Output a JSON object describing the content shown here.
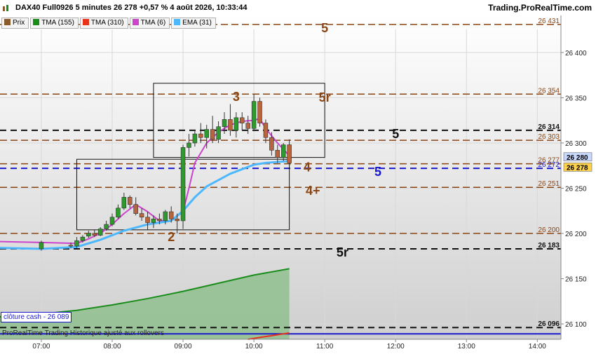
{
  "header": {
    "title": "DAX40 Full0926 5 minutes 26 278 +0,57 % 4 août 2026, 10:33:44",
    "brand": "Trading.ProRealTime.com"
  },
  "legend": [
    {
      "label": "Prix",
      "color": "#8b5a2b",
      "icon": "candlestick-icon"
    },
    {
      "label": "TMA (155)",
      "color": "#1a8c1a",
      "icon": "color-swatch-icon"
    },
    {
      "label": "TMA (310)",
      "color": "#e8331a",
      "icon": "color-swatch-icon"
    },
    {
      "label": "TMA (6)",
      "color": "#cc44cc",
      "icon": "color-swatch-icon"
    },
    {
      "label": "EMA (31)",
      "color": "#4db8ff",
      "icon": "color-swatch-icon"
    }
  ],
  "footer": {
    "cash_close": "clôture cash - 26 089",
    "note": "ProRealTime Trading Historique ajusté aux rollovers"
  },
  "chart_data": {
    "type": "candlestick",
    "ylim": [
      26083,
      26441
    ],
    "xlim": [
      "06:25",
      "14:20"
    ],
    "yticks": [
      26100,
      26150,
      26200,
      26250,
      26300,
      26350,
      26400
    ],
    "xticks": [
      "07:00",
      "08:00",
      "09:00",
      "10:00",
      "11:00",
      "12:00",
      "13:00",
      "14:00"
    ],
    "candles": [
      {
        "t": "07:00",
        "o": 26183,
        "h": 26192,
        "l": 26181,
        "c": 26190
      },
      {
        "t": "07:25",
        "o": 26187,
        "h": 26190,
        "l": 26184,
        "c": 26186
      },
      {
        "t": "07:30",
        "o": 26186,
        "h": 26196,
        "l": 26184,
        "c": 26192
      },
      {
        "t": "07:35",
        "o": 26192,
        "h": 26198,
        "l": 26190,
        "c": 26196
      },
      {
        "t": "07:40",
        "o": 26197,
        "h": 26203,
        "l": 26195,
        "c": 26200
      },
      {
        "t": "07:45",
        "o": 26200,
        "h": 26204,
        "l": 26196,
        "c": 26198
      },
      {
        "t": "07:50",
        "o": 26198,
        "h": 26207,
        "l": 26197,
        "c": 26205
      },
      {
        "t": "07:55",
        "o": 26205,
        "h": 26214,
        "l": 26203,
        "c": 26210
      },
      {
        "t": "08:00",
        "o": 26210,
        "h": 26222,
        "l": 26208,
        "c": 26218
      },
      {
        "t": "08:05",
        "o": 26218,
        "h": 26232,
        "l": 26216,
        "c": 26228
      },
      {
        "t": "08:10",
        "o": 26228,
        "h": 26245,
        "l": 26226,
        "c": 26240
      },
      {
        "t": "08:15",
        "o": 26240,
        "h": 26242,
        "l": 26228,
        "c": 26232
      },
      {
        "t": "08:20",
        "o": 26232,
        "h": 26240,
        "l": 26220,
        "c": 26222
      },
      {
        "t": "08:25",
        "o": 26222,
        "h": 26228,
        "l": 26214,
        "c": 26218
      },
      {
        "t": "08:30",
        "o": 26218,
        "h": 26224,
        "l": 26204,
        "c": 26212
      },
      {
        "t": "08:35",
        "o": 26212,
        "h": 26220,
        "l": 26206,
        "c": 26216
      },
      {
        "t": "08:40",
        "o": 26216,
        "h": 26222,
        "l": 26210,
        "c": 26214
      },
      {
        "t": "08:45",
        "o": 26214,
        "h": 26226,
        "l": 26210,
        "c": 26224
      },
      {
        "t": "08:50",
        "o": 26224,
        "h": 26230,
        "l": 26212,
        "c": 26216
      },
      {
        "t": "08:55",
        "o": 26216,
        "h": 26222,
        "l": 26200,
        "c": 26214
      },
      {
        "t": "09:00",
        "o": 26214,
        "h": 26298,
        "l": 26205,
        "c": 26295
      },
      {
        "t": "09:05",
        "o": 26295,
        "h": 26310,
        "l": 26285,
        "c": 26300
      },
      {
        "t": "09:10",
        "o": 26300,
        "h": 26314,
        "l": 26296,
        "c": 26310
      },
      {
        "t": "09:15",
        "o": 26310,
        "h": 26322,
        "l": 26300,
        "c": 26306
      },
      {
        "t": "09:20",
        "o": 26306,
        "h": 26320,
        "l": 26294,
        "c": 26315
      },
      {
        "t": "09:25",
        "o": 26315,
        "h": 26330,
        "l": 26300,
        "c": 26304
      },
      {
        "t": "09:30",
        "o": 26304,
        "h": 26324,
        "l": 26300,
        "c": 26318
      },
      {
        "t": "09:35",
        "o": 26318,
        "h": 26334,
        "l": 26310,
        "c": 26326
      },
      {
        "t": "09:40",
        "o": 26326,
        "h": 26343,
        "l": 26308,
        "c": 26314
      },
      {
        "t": "09:45",
        "o": 26314,
        "h": 26334,
        "l": 26306,
        "c": 26328
      },
      {
        "t": "09:50",
        "o": 26328,
        "h": 26334,
        "l": 26314,
        "c": 26322
      },
      {
        "t": "09:55",
        "o": 26322,
        "h": 26330,
        "l": 26310,
        "c": 26316
      },
      {
        "t": "10:00",
        "o": 26316,
        "h": 26354,
        "l": 26313,
        "c": 26346
      },
      {
        "t": "10:05",
        "o": 26346,
        "h": 26350,
        "l": 26318,
        "c": 26322
      },
      {
        "t": "10:10",
        "o": 26322,
        "h": 26326,
        "l": 26300,
        "c": 26306
      },
      {
        "t": "10:15",
        "o": 26306,
        "h": 26312,
        "l": 26286,
        "c": 26292
      },
      {
        "t": "10:20",
        "o": 26292,
        "h": 26298,
        "l": 26278,
        "c": 26284
      },
      {
        "t": "10:25",
        "o": 26284,
        "h": 26300,
        "l": 26280,
        "c": 26298
      },
      {
        "t": "10:30",
        "o": 26298,
        "h": 26304,
        "l": 26274,
        "c": 26278
      }
    ],
    "series": [
      {
        "name": "TMA (155)",
        "color": "#1a8c1a",
        "x": [
          "06:25",
          "07:00",
          "07:30",
          "08:00",
          "08:30",
          "09:00",
          "09:30",
          "10:00",
          "10:30"
        ],
        "y": [
          26108,
          26111,
          26115,
          26121,
          26128,
          26136,
          26145,
          26154,
          26161
        ]
      },
      {
        "name": "TMA (310)",
        "color": "#e8331a",
        "x": [
          "09:55",
          "10:05",
          "10:15",
          "10:25",
          "10:30"
        ],
        "y": [
          26083,
          26085,
          26087,
          26089,
          26090
        ]
      },
      {
        "name": "TMA (6)",
        "color": "#cc44cc",
        "x": [
          "06:25",
          "07:00",
          "07:30",
          "07:40",
          "07:50",
          "08:00",
          "08:10",
          "08:20",
          "08:30",
          "08:40",
          "08:50",
          "09:00",
          "09:05",
          "09:10",
          "09:20",
          "09:30",
          "09:40",
          "09:50",
          "10:00",
          "10:05",
          "10:10",
          "10:20",
          "10:30"
        ],
        "y": [
          26191,
          26190,
          26189,
          26194,
          26200,
          26210,
          26222,
          26232,
          26224,
          26214,
          26214,
          26224,
          26250,
          26278,
          26300,
          26312,
          26320,
          26324,
          26325,
          26327,
          26316,
          26300,
          26286
        ]
      },
      {
        "name": "EMA (31)",
        "color": "#4db8ff",
        "x": [
          "06:25",
          "07:00",
          "07:30",
          "07:50",
          "08:10",
          "08:30",
          "08:50",
          "09:00",
          "09:10",
          "09:20",
          "09:40",
          "10:00",
          "10:10",
          "10:20",
          "10:30"
        ],
        "y": [
          26184,
          26183,
          26185,
          26193,
          26203,
          26210,
          26214,
          26225,
          26240,
          26252,
          26266,
          26276,
          26278,
          26279,
          26280
        ]
      }
    ],
    "hlines": [
      {
        "y": 26431,
        "label": "26 431",
        "color": "#8b4513",
        "style": "dash-long"
      },
      {
        "y": 26354,
        "label": "26 354",
        "color": "#8b4513",
        "style": "dash-long"
      },
      {
        "y": 26314,
        "label": "26 314",
        "color": "#111111",
        "style": "dash-black"
      },
      {
        "y": 26303,
        "label": "26 303",
        "color": "#8b4513",
        "style": "dash-long"
      },
      {
        "y": 26277,
        "label": "26 277",
        "color": "#8b4513",
        "style": "dash-long"
      },
      {
        "y": 26272,
        "label": "26 272",
        "color": "#1a1acc",
        "style": "dash-blue"
      },
      {
        "y": 26251,
        "label": "26 251",
        "color": "#8b4513",
        "style": "dash-long"
      },
      {
        "y": 26200,
        "label": "26 200",
        "color": "#8b4513",
        "style": "dash-long"
      },
      {
        "y": 26183,
        "label": "26 183",
        "color": "#111111",
        "style": "dash-black"
      },
      {
        "y": 26096,
        "label": "26 096",
        "color": "#111111",
        "style": "dash-black"
      }
    ],
    "solid_line": {
      "y": 26089,
      "color": "#1a1acc"
    },
    "rects": [
      {
        "t1": "07:30",
        "t2": "10:30",
        "y1": 26204,
        "y2": 26282
      },
      {
        "t1": "08:35",
        "t2": "11:00",
        "y1": 26284,
        "y2": 26366
      }
    ],
    "annotations": [
      {
        "text": "5",
        "t": "11:00",
        "y": 26428,
        "color": "#8b4513"
      },
      {
        "text": "5r",
        "t": "11:00",
        "y": 26351,
        "color": "#8b4513"
      },
      {
        "text": "3",
        "t": "09:45",
        "y": 26352,
        "color": "#8b4513"
      },
      {
        "text": "5",
        "t": "12:00",
        "y": 26311,
        "color": "#111111"
      },
      {
        "text": "4",
        "t": "10:45",
        "y": 26274,
        "color": "#8b4513"
      },
      {
        "text": "5",
        "t": "11:45",
        "y": 26269,
        "color": "#1a1acc"
      },
      {
        "text": "4+",
        "t": "10:50",
        "y": 26248,
        "color": "#8b4513"
      },
      {
        "text": "2",
        "t": "08:50",
        "y": 26197,
        "color": "#8b4513"
      },
      {
        "text": "5r",
        "t": "11:15",
        "y": 26180,
        "color": "#111111"
      }
    ],
    "price_tags": [
      {
        "value": "26 280",
        "y": 26280,
        "bg": "#c8d8ff",
        "color": "#000000"
      },
      {
        "value": "26 278",
        "y": 26278,
        "bg": "#ffd24d",
        "color": "#000000"
      }
    ]
  }
}
